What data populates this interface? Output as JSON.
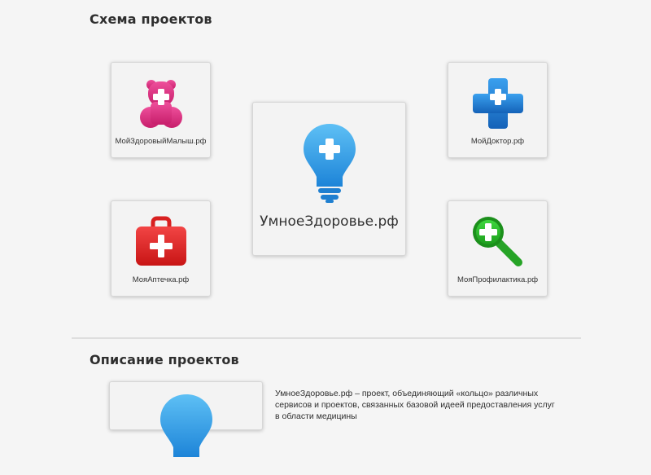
{
  "scheme": {
    "title": "Схема проектов",
    "center": {
      "label": "УмноеЗдоровье.рф",
      "icon": "lightbulb-plus-icon"
    },
    "projects": [
      {
        "label": "МойЗдоровыйМалыш.рф",
        "icon": "teddy-bear-plus-icon",
        "color": "#d42c7a"
      },
      {
        "label": "МойДоктор.рф",
        "icon": "medical-cross-icon",
        "color": "#1f7fd6"
      },
      {
        "label": "МояАптечка.рф",
        "icon": "first-aid-kit-icon",
        "color": "#e02424"
      },
      {
        "label": "МояПрофилактика.рф",
        "icon": "magnifier-plus-icon",
        "color": "#2ca82c"
      }
    ]
  },
  "description": {
    "title": "Описание проектов",
    "text": "УмноеЗдоровье.рф – проект, объединяющий «кольцо» различных сервисов и проектов, связанных базовой идеей предоставления услуг в области медицины"
  }
}
